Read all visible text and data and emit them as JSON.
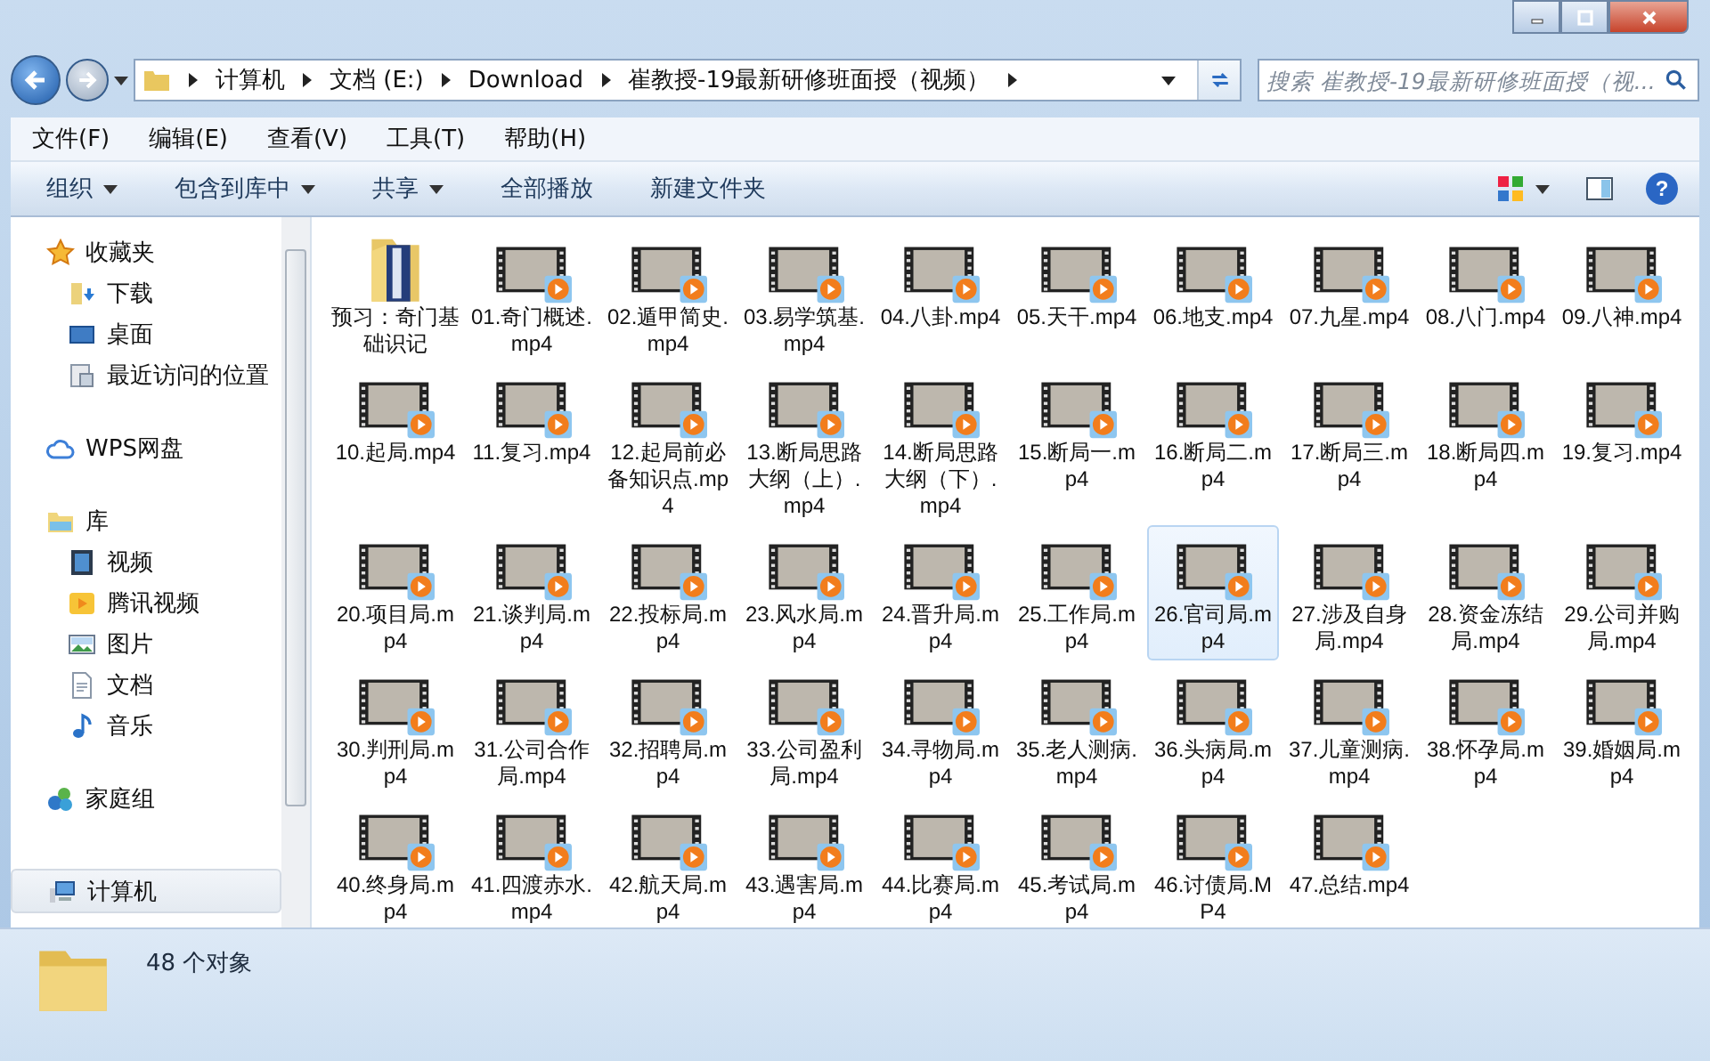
{
  "address_bar": {
    "path": [
      "计算机",
      "文档 (E:)",
      "Download",
      "崔教授-19最新研修班面授（视频）"
    ]
  },
  "search": {
    "placeholder": "搜索 崔教授-19最新研修班面授（视..."
  },
  "menu": [
    "文件(F)",
    "编辑(E)",
    "查看(V)",
    "工具(T)",
    "帮助(H)"
  ],
  "toolbar": [
    {
      "label": "组织",
      "dropdown": true
    },
    {
      "label": "包含到库中",
      "dropdown": true
    },
    {
      "label": "共享",
      "dropdown": true
    },
    {
      "label": "全部播放",
      "dropdown": false
    },
    {
      "label": "新建文件夹",
      "dropdown": false
    }
  ],
  "sidebar": [
    {
      "label": "收藏夹",
      "kind": "star",
      "selected": false,
      "children": [
        {
          "label": "下载",
          "kind": "download",
          "selected": false
        },
        {
          "label": "桌面",
          "kind": "desktop",
          "selected": false
        },
        {
          "label": "最近访问的位置",
          "kind": "recent",
          "selected": false
        }
      ]
    },
    {
      "label": "WPS网盘",
      "kind": "cloud",
      "selected": false
    },
    {
      "label": "库",
      "kind": "library",
      "selected": false,
      "children": [
        {
          "label": "视频",
          "kind": "video",
          "selected": false
        },
        {
          "label": "腾讯视频",
          "kind": "tencent",
          "selected": false
        },
        {
          "label": "图片",
          "kind": "picture",
          "selected": false
        },
        {
          "label": "文档",
          "kind": "document",
          "selected": false
        },
        {
          "label": "音乐",
          "kind": "music",
          "selected": false
        }
      ]
    },
    {
      "label": "家庭组",
      "kind": "homegroup",
      "selected": false
    },
    {
      "label": "计算机",
      "kind": "computer",
      "selected": true
    }
  ],
  "help_button": "?",
  "files": [
    {
      "name": "预习：奇门基础识记",
      "kind": "folder",
      "selected": false
    },
    {
      "name": "01.奇门概述.mp4",
      "kind": "video",
      "selected": false
    },
    {
      "name": "02.遁甲简史.mp4",
      "kind": "video",
      "selected": false
    },
    {
      "name": "03.易学筑基.mp4",
      "kind": "video",
      "selected": false
    },
    {
      "name": "04.八卦.mp4",
      "kind": "video",
      "selected": false
    },
    {
      "name": "05.天干.mp4",
      "kind": "video",
      "selected": false
    },
    {
      "name": "06.地支.mp4",
      "kind": "video",
      "selected": false
    },
    {
      "name": "07.九星.mp4",
      "kind": "video",
      "selected": false
    },
    {
      "name": "08.八门.mp4",
      "kind": "video",
      "selected": false
    },
    {
      "name": "09.八神.mp4",
      "kind": "video",
      "selected": false
    },
    {
      "name": "10.起局.mp4",
      "kind": "video",
      "selected": false
    },
    {
      "name": "11.复习.mp4",
      "kind": "video",
      "selected": false
    },
    {
      "name": "12.起局前必备知识点.mp4",
      "kind": "video",
      "selected": false
    },
    {
      "name": "13.断局思路大纲（上）.mp4",
      "kind": "video",
      "selected": false
    },
    {
      "name": "14.断局思路大纲（下）.mp4",
      "kind": "video",
      "selected": false
    },
    {
      "name": "15.断局一.mp4",
      "kind": "video",
      "selected": false
    },
    {
      "name": "16.断局二.mp4",
      "kind": "video",
      "selected": false
    },
    {
      "name": "17.断局三.mp4",
      "kind": "video",
      "selected": false
    },
    {
      "name": "18.断局四.mp4",
      "kind": "video",
      "selected": false
    },
    {
      "name": "19.复习.mp4",
      "kind": "video",
      "selected": false
    },
    {
      "name": "20.项目局.mp4",
      "kind": "video",
      "selected": false
    },
    {
      "name": "21.谈判局.mp4",
      "kind": "video",
      "selected": false
    },
    {
      "name": "22.投标局.mp4",
      "kind": "video",
      "selected": false
    },
    {
      "name": "23.风水局.mp4",
      "kind": "video",
      "selected": false
    },
    {
      "name": "24.晋升局.mp4",
      "kind": "video",
      "selected": false
    },
    {
      "name": "25.工作局.mp4",
      "kind": "video",
      "selected": false
    },
    {
      "name": "26.官司局.mp4",
      "kind": "video",
      "selected": true
    },
    {
      "name": "27.涉及自身局.mp4",
      "kind": "video",
      "selected": false
    },
    {
      "name": "28.资金冻结局.mp4",
      "kind": "video",
      "selected": false
    },
    {
      "name": "29.公司并购局.mp4",
      "kind": "video",
      "selected": false
    },
    {
      "name": "30.判刑局.mp4",
      "kind": "video",
      "selected": false
    },
    {
      "name": "31.公司合作局.mp4",
      "kind": "video",
      "selected": false
    },
    {
      "name": "32.招聘局.mp4",
      "kind": "video",
      "selected": false
    },
    {
      "name": "33.公司盈利局.mp4",
      "kind": "video",
      "selected": false
    },
    {
      "name": "34.寻物局.mp4",
      "kind": "video",
      "selected": false
    },
    {
      "name": "35.老人测病.mp4",
      "kind": "video",
      "selected": false
    },
    {
      "name": "36.头病局.mp4",
      "kind": "video",
      "selected": false
    },
    {
      "name": "37.儿童测病.mp4",
      "kind": "video",
      "selected": false
    },
    {
      "name": "38.怀孕局.mp4",
      "kind": "video",
      "selected": false
    },
    {
      "name": "39.婚姻局.mp4",
      "kind": "video",
      "selected": false
    },
    {
      "name": "40.终身局.mp4",
      "kind": "video",
      "selected": false
    },
    {
      "name": "41.四渡赤水.mp4",
      "kind": "video",
      "selected": false
    },
    {
      "name": "42.航天局.mp4",
      "kind": "video",
      "selected": false
    },
    {
      "name": "43.遇害局.mp4",
      "kind": "video",
      "selected": false
    },
    {
      "name": "44.比赛局.mp4",
      "kind": "video",
      "selected": false
    },
    {
      "name": "45.考试局.mp4",
      "kind": "video",
      "selected": false
    },
    {
      "name": "46.讨债局.MP4",
      "kind": "video",
      "selected": false
    },
    {
      "name": "47.总结.mp4",
      "kind": "video",
      "selected": false
    }
  ],
  "status_bar": {
    "count": "48 个对象"
  }
}
